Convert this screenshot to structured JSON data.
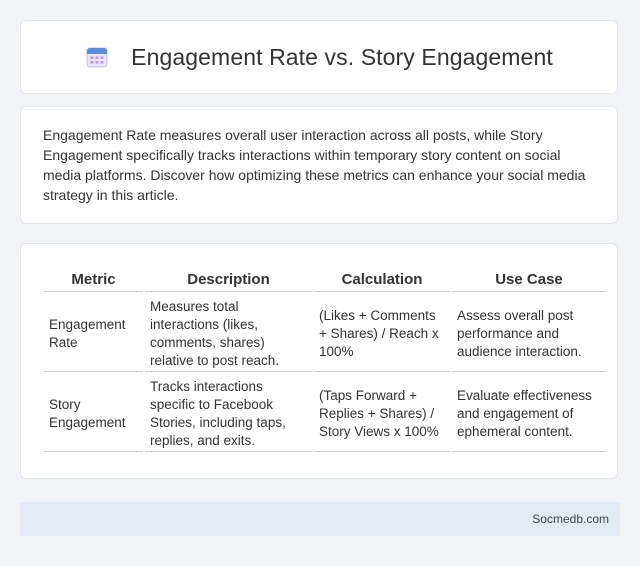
{
  "header": {
    "title": "Engagement Rate vs. Story Engagement",
    "icon": "calendar-icon"
  },
  "intro": {
    "text": "Engagement Rate measures overall user interaction across all posts, while Story Engagement specifically tracks interactions within temporary story content on social media platforms. Discover how optimizing these metrics can enhance your social media strategy in this article."
  },
  "table": {
    "headers": [
      "Metric",
      "Description",
      "Calculation",
      "Use Case"
    ],
    "rows": [
      [
        "Engagement Rate",
        "Measures total interactions (likes, comments, shares) relative to post reach.",
        "(Likes + Comments + Shares) / Reach x 100%",
        "Assess overall post performance and audience interaction."
      ],
      [
        "Story Engagement",
        "Tracks interactions specific to Facebook Stories, including taps, replies, and exits.",
        "(Taps Forward + Replies + Shares) / Story Views x 100%",
        "Evaluate effectiveness and engagement of ephemeral content."
      ]
    ]
  },
  "footer": {
    "source": "Socmedb.com"
  }
}
